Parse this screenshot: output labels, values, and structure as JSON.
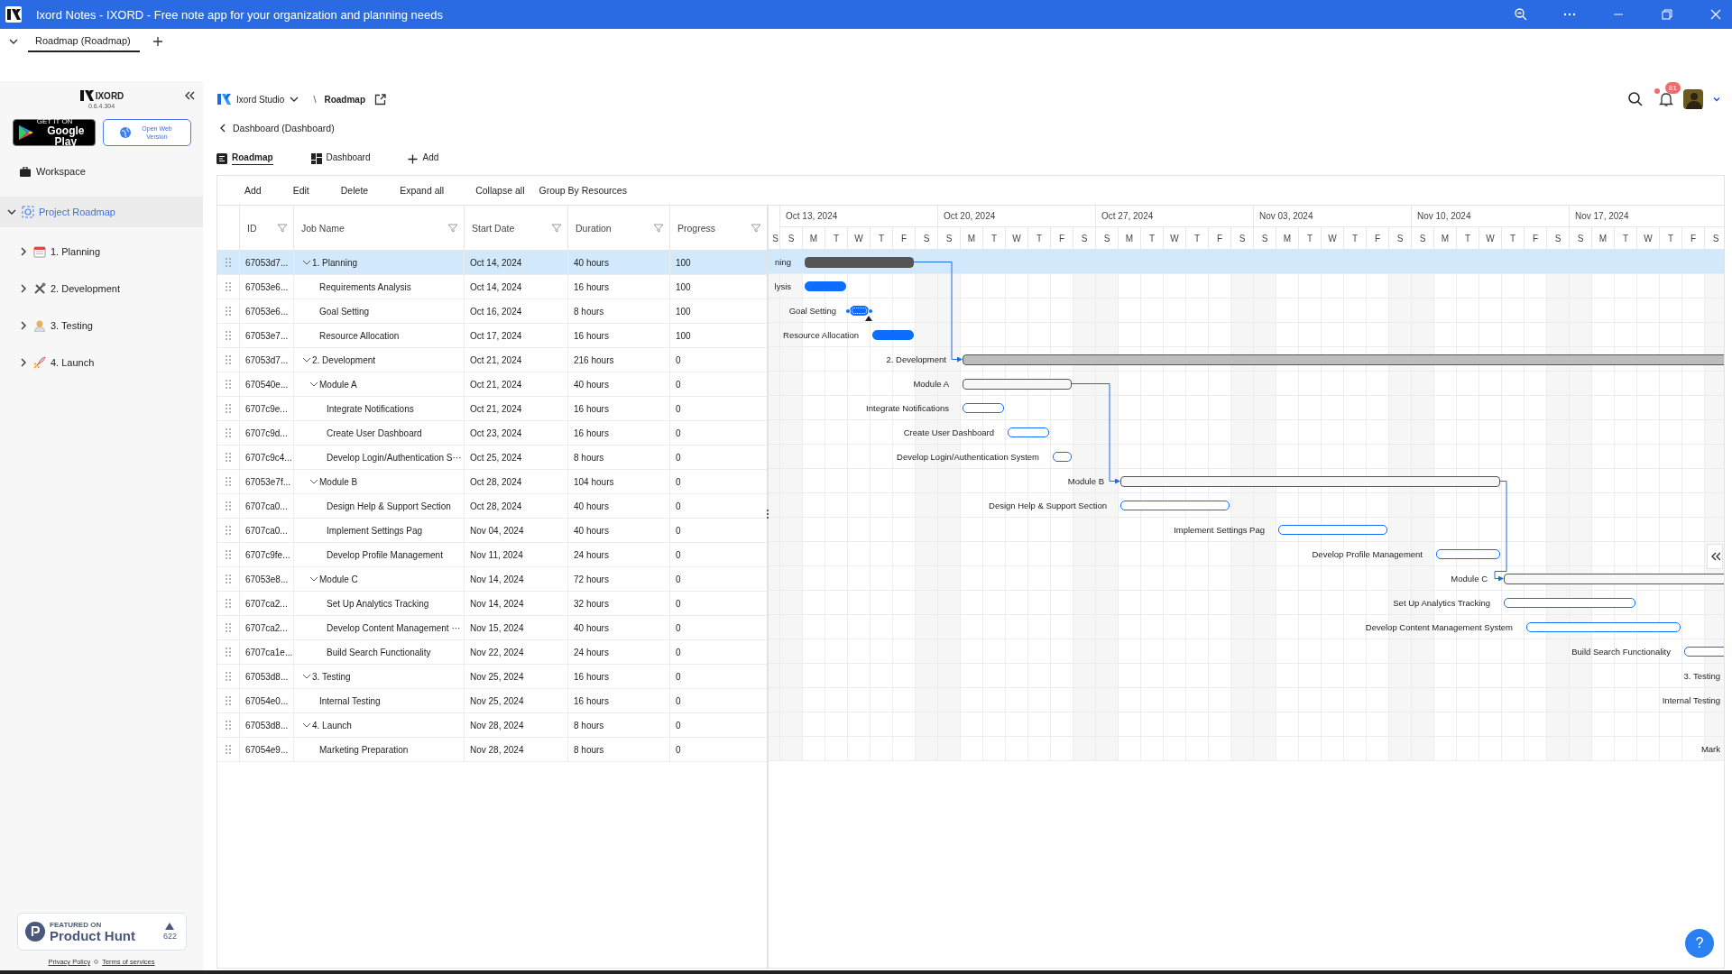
{
  "window": {
    "title": "Ixord Notes - IXORD - Free note app for your organization and planning needs"
  },
  "doc_tabs": [
    {
      "label": "Roadmap (Roadmap)",
      "selected": true
    }
  ],
  "sidebar": {
    "brand": "IXORD",
    "version": "0.6.4.304",
    "store_button": {
      "small": "GET IT ON",
      "large": "Google Play"
    },
    "web_button": "Open Web Version",
    "workspace": "Workspace",
    "tree": [
      {
        "label": "Project Roadmap",
        "expanded": true,
        "selected": true,
        "children": [
          {
            "label": "1. Planning",
            "expanded": false,
            "selected": false
          },
          {
            "label": "2. Development",
            "expanded": false,
            "selected": false
          },
          {
            "label": "3. Testing",
            "expanded": false,
            "selected": false
          },
          {
            "label": "4. Launch",
            "expanded": false,
            "selected": false
          }
        ]
      }
    ],
    "product_hunt": {
      "small": "FEATURED ON",
      "large": "Product Hunt",
      "votes": "622"
    },
    "links": [
      "Privacy Policy",
      "Terms of services"
    ]
  },
  "header": {
    "workspace": "Ixord Studio",
    "separator": "\\",
    "page": "Roadmap",
    "back": "Dashboard (Dashboard)",
    "notifications": "81"
  },
  "view_tabs": [
    {
      "label": "Roadmap",
      "kind": "roadmap",
      "selected": true
    },
    {
      "label": "Dashboard",
      "kind": "dashboard",
      "selected": false
    },
    {
      "label": "Add",
      "kind": "add",
      "selected": false
    }
  ],
  "toolbar": [
    "Add",
    "Edit",
    "Delete",
    "Expand all",
    "Collapse all",
    "Group By Resources"
  ],
  "table": {
    "columns": [
      "ID",
      "Job Name",
      "Start Date",
      "Duration",
      "Progress"
    ],
    "rows": [
      {
        "id": "67053d7...",
        "name": "1. Planning",
        "start": "Oct 14, 2024",
        "duration": "40 hours",
        "progress": "100",
        "expanded": true,
        "selected": true,
        "children": [
          {
            "id": "67053e6...",
            "name": "Requirements Analysis",
            "start": "Oct 14, 2024",
            "duration": "16 hours",
            "progress": "100",
            "selected": false
          },
          {
            "id": "67053e6...",
            "name": "Goal Setting",
            "start": "Oct 16, 2024",
            "duration": "8 hours",
            "progress": "100",
            "selected": false
          },
          {
            "id": "67053e7...",
            "name": "Resource Allocation",
            "start": "Oct 17, 2024",
            "duration": "16 hours",
            "progress": "100",
            "selected": false
          }
        ]
      },
      {
        "id": "67053d7...",
        "name": "2. Development",
        "start": "Oct 21, 2024",
        "duration": "216 hours",
        "progress": "0",
        "expanded": true,
        "selected": false,
        "children": [
          {
            "id": "670540e...",
            "name": "Module A",
            "start": "Oct 21, 2024",
            "duration": "40 hours",
            "progress": "0",
            "expanded": true,
            "selected": false,
            "children": [
              {
                "id": "6707c9e...",
                "name": "Integrate Notifications",
                "start": "Oct 21, 2024",
                "duration": "16 hours",
                "progress": "0",
                "selected": false
              },
              {
                "id": "6707c9d...",
                "name": "Create User Dashboard",
                "start": "Oct 23, 2024",
                "duration": "16 hours",
                "progress": "0",
                "selected": false
              },
              {
                "id": "6707c9c4...",
                "name": "Develop Login/Authentication S···",
                "start": "Oct 25, 2024",
                "duration": "8 hours",
                "progress": "0",
                "selected": false
              }
            ]
          },
          {
            "id": "67053e7f...",
            "name": "Module B",
            "start": "Oct 28, 2024",
            "duration": "104 hours",
            "progress": "0",
            "expanded": true,
            "selected": false,
            "children": [
              {
                "id": "6707ca0...",
                "name": "Design Help & Support Section",
                "start": "Oct 28, 2024",
                "duration": "40 hours",
                "progress": "0",
                "selected": false
              },
              {
                "id": "6707ca0...",
                "name": "Implement Settings Pag",
                "start": "Nov 04, 2024",
                "duration": "40 hours",
                "progress": "0",
                "selected": false
              },
              {
                "id": "6707c9fe...",
                "name": "Develop Profile Management",
                "start": "Nov 11, 2024",
                "duration": "24 hours",
                "progress": "0",
                "selected": false
              }
            ]
          },
          {
            "id": "67053e8...",
            "name": "Module C",
            "start": "Nov 14, 2024",
            "duration": "72 hours",
            "progress": "0",
            "expanded": true,
            "selected": false,
            "children": [
              {
                "id": "6707ca2...",
                "name": "Set Up Analytics Tracking",
                "start": "Nov 14, 2024",
                "duration": "32 hours",
                "progress": "0",
                "selected": false
              },
              {
                "id": "6707ca2...",
                "name": "Develop Content Management ···",
                "start": "Nov 15, 2024",
                "duration": "40 hours",
                "progress": "0",
                "selected": false
              },
              {
                "id": "6707ca1e...",
                "name": "Build Search Functionality",
                "start": "Nov 22, 2024",
                "duration": "24 hours",
                "progress": "0",
                "selected": false
              }
            ]
          }
        ]
      },
      {
        "id": "67053d8...",
        "name": "3. Testing",
        "start": "Nov 25, 2024",
        "duration": "16 hours",
        "progress": "0",
        "expanded": true,
        "selected": false,
        "children": [
          {
            "id": "67054e0...",
            "name": "Internal Testing",
            "start": "Nov 25, 2024",
            "duration": "16 hours",
            "progress": "0",
            "selected": false
          }
        ]
      },
      {
        "id": "67053d8...",
        "name": "4. Launch",
        "start": "Nov 28, 2024",
        "duration": "8 hours",
        "progress": "0",
        "expanded": true,
        "selected": false,
        "children": [
          {
            "id": "67054e9...",
            "name": "Marketing Preparation",
            "start": "Nov 28, 2024",
            "duration": "8 hours",
            "progress": "0",
            "selected": false
          }
        ]
      }
    ]
  },
  "timeline": {
    "weeks": [
      "Oct 13, 2024",
      "Oct 20, 2024",
      "Oct 27, 2024",
      "Nov 03, 2024",
      "Nov 10, 2024",
      "Nov 17, 2024"
    ],
    "days": [
      "S",
      "S",
      "M",
      "T",
      "W",
      "T",
      "F",
      "S",
      "S",
      "M",
      "T",
      "W",
      "T",
      "F",
      "S",
      "S",
      "M",
      "T",
      "W",
      "T",
      "F",
      "S",
      "S",
      "M",
      "T",
      "W",
      "T",
      "F",
      "S",
      "S",
      "M",
      "T",
      "W",
      "T",
      "F",
      "S",
      "S",
      "M",
      "T",
      "W",
      "T",
      "F",
      "S"
    ],
    "bars": [
      {
        "kind": "summary",
        "label": "ning"
      },
      {
        "kind": "task",
        "label": "lysis"
      },
      {
        "kind": "task",
        "label": "Goal Setting",
        "active": true
      },
      {
        "kind": "task",
        "label": "Resource Allocation"
      },
      {
        "kind": "summary",
        "label": "2. Development",
        "linked": true
      },
      {
        "kind": "summary",
        "label": "Module A"
      },
      {
        "kind": "task",
        "label": "Integrate Notifications"
      },
      {
        "kind": "task",
        "label": "Create User Dashboard"
      },
      {
        "kind": "task",
        "label": "Develop Login/Authentication System"
      },
      {
        "kind": "summary",
        "label": "Module B",
        "linked": true
      },
      {
        "kind": "task",
        "label": "Design Help & Support Section"
      },
      {
        "kind": "task",
        "label": "Implement Settings Pag"
      },
      {
        "kind": "task",
        "label": "Develop Profile Management"
      },
      {
        "kind": "summary",
        "label": "Module C",
        "linked": true
      },
      {
        "kind": "task",
        "label": "Set Up Analytics Tracking"
      },
      {
        "kind": "task",
        "label": "Develop Content Management System"
      },
      {
        "kind": "task",
        "label": "Build Search Functionality"
      },
      {
        "kind": "summary",
        "label": "3. Testing"
      },
      {
        "kind": "task",
        "label": "Internal Testing"
      },
      {
        "kind": "summary"
      },
      {
        "kind": "task",
        "label": "Mark"
      }
    ]
  },
  "help": "?"
}
